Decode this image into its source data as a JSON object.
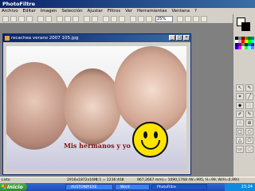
{
  "app": {
    "title": "PhotoFiltre"
  },
  "menu": [
    "Archivo",
    "Editar",
    "Imagen",
    "Selección",
    "Ajustar",
    "Filtros",
    "Ver",
    "Herramientas",
    "Ventana",
    "?"
  ],
  "toolbar": {
    "zoom": "25%"
  },
  "document": {
    "title": "recachea verano 2007 105.jpg",
    "caption": "Mis hermanos y yo"
  },
  "status": {
    "ready": "Listo",
    "size": "2916x1872x16M",
    "ratio": "1:1 = 2236:408",
    "coords": "967,2667 mm(= 1090,1768 (W=995, H=99, W/H=0,99))"
  },
  "taskbar": {
    "start": "Inicio",
    "tasks": [
      "AUSTONIP.EXE",
      "Word",
      "PhotoFiltre"
    ],
    "clock": "23:24"
  },
  "colors": {
    "titlebar": "#0a246a",
    "accent": "#3a6ea5",
    "smiley": "#ffe400",
    "caption": "#8a1010"
  }
}
